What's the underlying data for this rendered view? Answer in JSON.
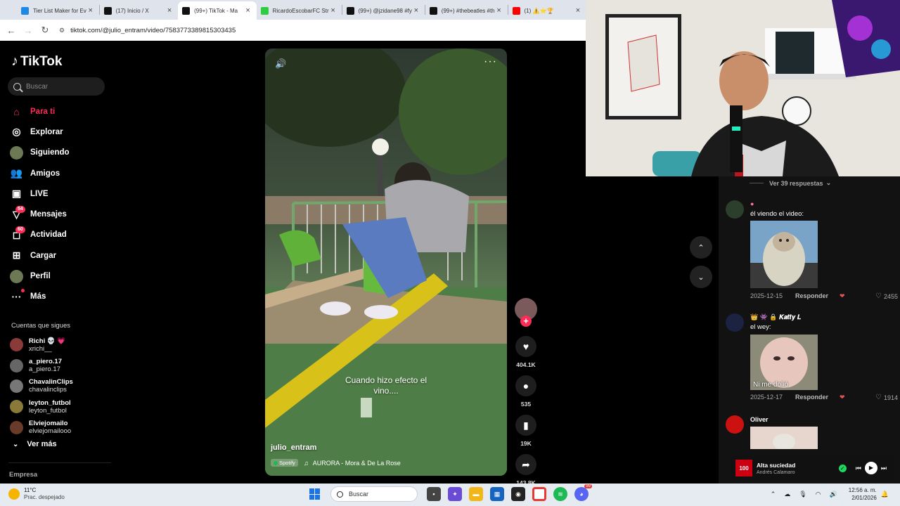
{
  "browser": {
    "tabs": [
      {
        "title": "Tier List Maker for Ev",
        "color": "#1e88e5",
        "active": false
      },
      {
        "title": "(17) Inicio / X",
        "color": "#111111",
        "active": false
      },
      {
        "title": "(99+) TikTok - Ma",
        "color": "#111111",
        "active": true
      },
      {
        "title": "RicardoEscobarFC Str",
        "color": "#2ecc40",
        "active": false
      },
      {
        "title": "(99+) @jzidane98 #fy",
        "color": "#111111",
        "active": false
      },
      {
        "title": "(99+) #thebeatles #th",
        "color": "#111111",
        "active": false
      },
      {
        "title": "(1) ⚠️⭐🏆",
        "color": "#ff0000",
        "active": false
      }
    ],
    "url": "tiktok.com/@julio_entram/video/7583773389815303435"
  },
  "sidebar": {
    "logo": "TikTok",
    "search_placeholder": "Buscar",
    "nav": [
      {
        "label": "Para ti",
        "icon": "home-icon",
        "glyph": "⌂",
        "active": true,
        "badge": ""
      },
      {
        "label": "Explorar",
        "icon": "compass-icon",
        "glyph": "◎",
        "active": false,
        "badge": ""
      },
      {
        "label": "Siguiendo",
        "icon": "following-avatar-icon",
        "glyph": "●",
        "active": false,
        "badge": ""
      },
      {
        "label": "Amigos",
        "icon": "friends-icon",
        "glyph": "👥",
        "active": false,
        "badge": ""
      },
      {
        "label": "LIVE",
        "icon": "live-tv-icon",
        "glyph": "▣",
        "active": false,
        "badge": ""
      },
      {
        "label": "Mensajes",
        "icon": "messages-icon",
        "glyph": "▽",
        "active": false,
        "badge": "54"
      },
      {
        "label": "Actividad",
        "icon": "activity-icon",
        "glyph": "◻",
        "active": false,
        "badge": "60"
      },
      {
        "label": "Cargar",
        "icon": "upload-icon",
        "glyph": "⊞",
        "active": false,
        "badge": ""
      },
      {
        "label": "Perfil",
        "icon": "profile-avatar-icon",
        "glyph": "●",
        "active": false,
        "badge": ""
      },
      {
        "label": "Más",
        "icon": "more-icon",
        "glyph": "···",
        "active": false,
        "badge": ""
      }
    ],
    "following_title": "Cuentas que sigues",
    "following": [
      {
        "name": "Richi 💀 💗",
        "handle": "xrichi__",
        "color": "#8b3a3a"
      },
      {
        "name": "a_piero.17",
        "handle": "a_piero.17",
        "color": "#666666"
      },
      {
        "name": "ChavalinClips",
        "handle": "chavalinclips",
        "color": "#777777"
      },
      {
        "name": "leyton_futbol",
        "handle": "leyton_futbol",
        "color": "#8a7a3a"
      },
      {
        "name": "Elviejomailo",
        "handle": "elviejomailooo",
        "color": "#6a3a2a"
      }
    ],
    "see_more": "Ver más",
    "company": "Empresa"
  },
  "video": {
    "caption_line1": "Cuando hizo efecto el",
    "caption_line2": "vino....",
    "author": "julio_entram",
    "spotify_label": "Spotify",
    "music": "AURORA - Mora & De La Rose"
  },
  "actions": {
    "likes": "404.1K",
    "comments": "535",
    "saves": "19K",
    "shares": "143.8K"
  },
  "comments": {
    "view_replies": "Ver 39 respuestas",
    "items": [
      {
        "name": "",
        "text": "él viendo el video:",
        "date": "2025-12-15",
        "reply": "Responder",
        "likes": "2455",
        "avatar": "#2c3e2c"
      },
      {
        "name": "👑 👾 🔒 𝑲𝒂𝒕𝒕𝒚 𝑳",
        "text": "el wey:",
        "date": "2025-12-17",
        "reply": "Responder",
        "likes": "1914",
        "sticker_text": "Ni me dolió",
        "avatar": "#1c2340"
      },
      {
        "name": "Oliver",
        "text": "",
        "avatar": "#cc1111"
      }
    ]
  },
  "player": {
    "track": "Alta suciedad",
    "artist": "Andrés Calamaro",
    "art_label": "100"
  },
  "taskbar": {
    "temp": "11°C",
    "weather": "Prac. despejado",
    "search": "Buscar",
    "time": "12:56 a. m.",
    "date": "2/01/2026",
    "notif_badge": "99"
  }
}
